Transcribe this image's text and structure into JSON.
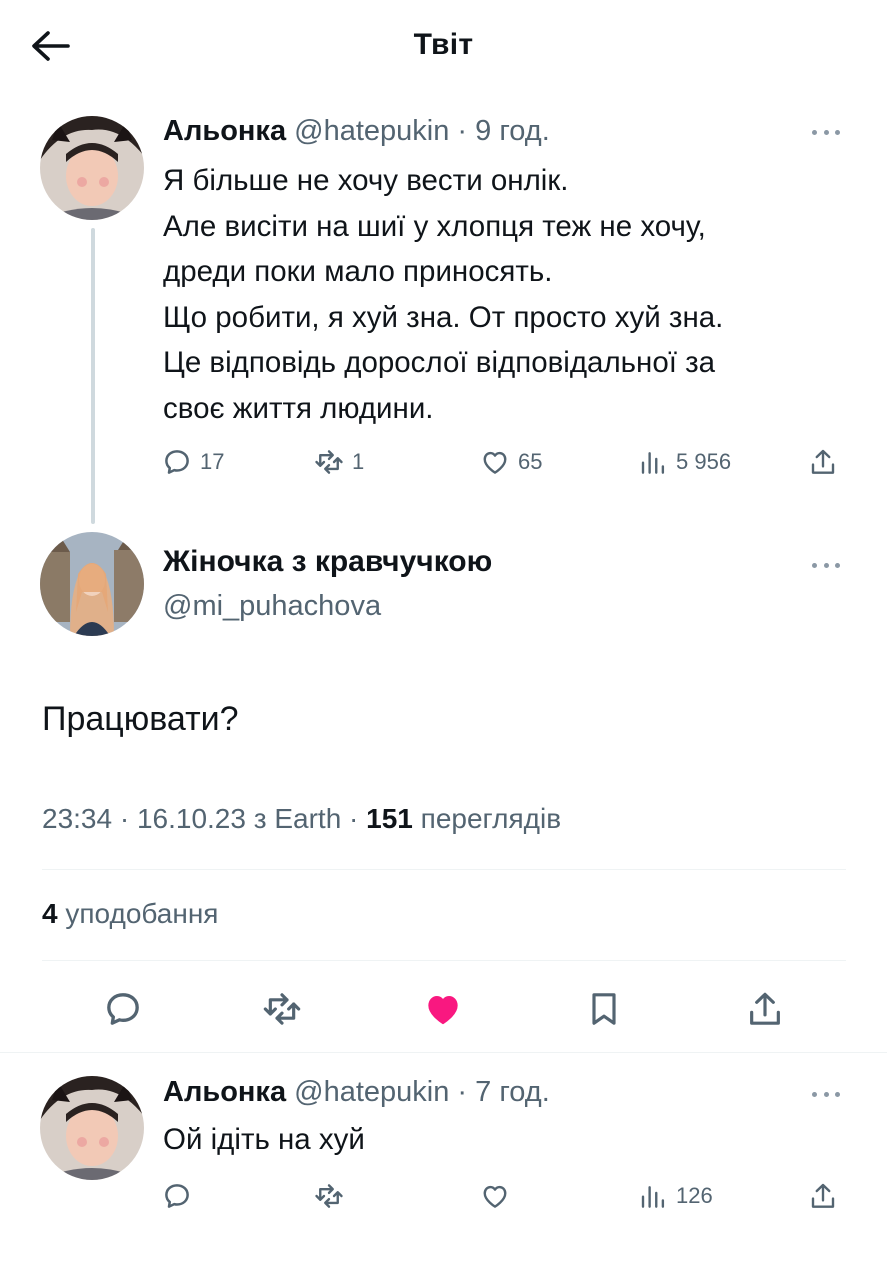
{
  "header": {
    "title": "Твіт",
    "back_icon": "arrow-left-icon"
  },
  "parent_tweet": {
    "name": "Альонка",
    "handle": "@hatepukin",
    "separator": "·",
    "time": "9 год.",
    "lines": [
      "Я більше не хочу вести онлік.",
      "Але висіти на шиї у хлопця теж не хочу,",
      "дреди поки мало приносять.",
      "Що робити, я хуй зна. От просто хуй зна.",
      "Це відповідь дорослої відповідальної за",
      "своє життя людини."
    ],
    "stats": {
      "replies": "17",
      "retweets": "1",
      "likes": "65",
      "views": "5 956"
    }
  },
  "main_tweet": {
    "name": "Жіночка з кравчучкою",
    "handle": "@mi_puhachova",
    "text": "Працювати?",
    "meta_prefix": "23:34 · 16.10.23 з Earth · ",
    "views_count": "151",
    "views_label": " переглядів",
    "likes_count": "4",
    "likes_label": " уподобання",
    "liked": true
  },
  "reply_tweet": {
    "name": "Альонка",
    "handle": "@hatepukin",
    "separator": "·",
    "time": "7 год.",
    "text": "Ой ідіть на хуй",
    "stats": {
      "views": "126"
    }
  },
  "colors": {
    "text": "#0f1419",
    "secondary": "#536471",
    "like_pink": "#f91880",
    "divider": "#eff3f4",
    "thread_line": "#cfd9de"
  },
  "icons": [
    "arrow-left-icon",
    "more-icon",
    "reply-icon",
    "retweet-icon",
    "heart-icon",
    "views-icon",
    "share-icon",
    "bookmark-icon"
  ]
}
